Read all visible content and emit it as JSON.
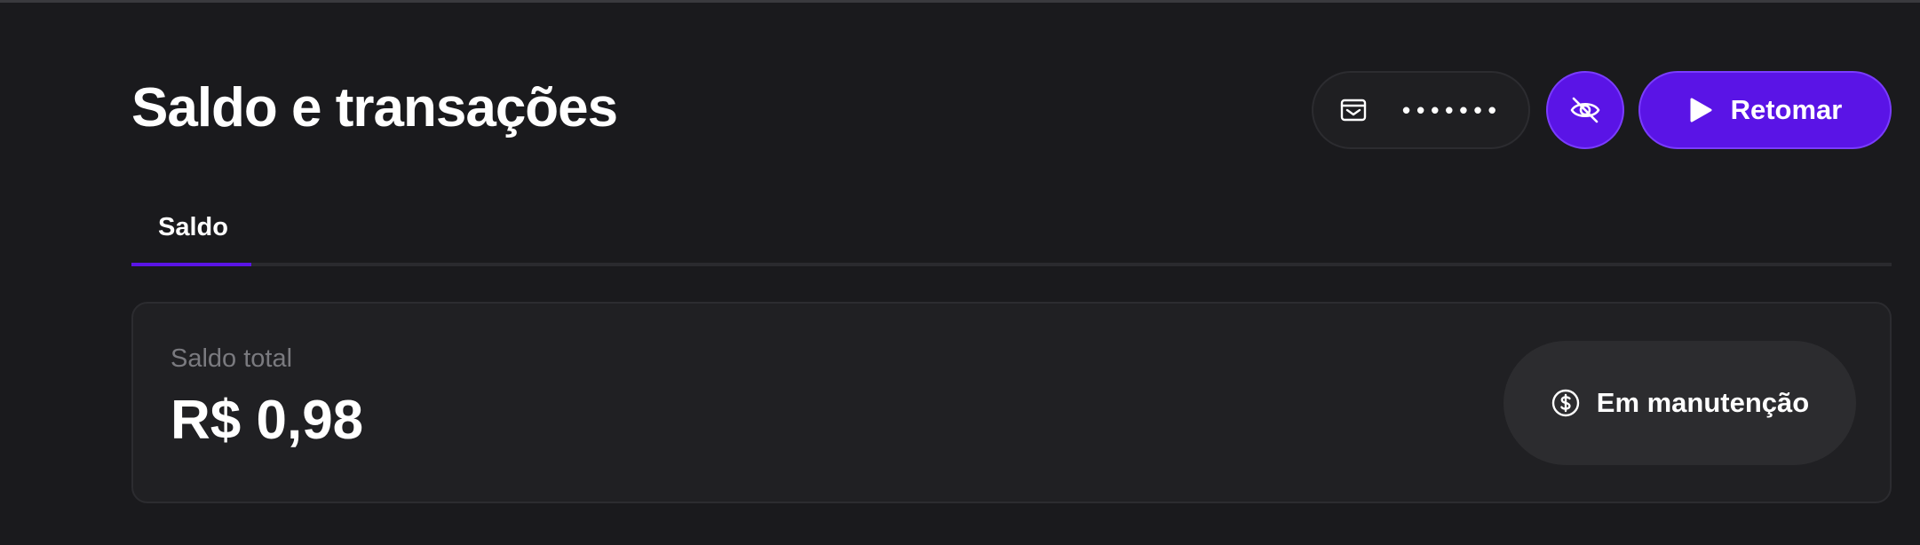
{
  "header": {
    "title": "Saldo e transações",
    "wallet": {
      "icon": "wallet-icon",
      "masked_value": "•••••••"
    },
    "visibility_toggle": {
      "icon": "eye-off-icon"
    },
    "resume_button": {
      "icon": "play-icon",
      "label": "Retomar"
    }
  },
  "tabs": [
    {
      "label": "Saldo",
      "active": true
    }
  ],
  "balance_card": {
    "label": "Saldo total",
    "value": "R$ 0,98",
    "status": {
      "icon": "dollar-circle-icon",
      "label": "Em manutenção"
    }
  },
  "colors": {
    "background": "#1a1a1d",
    "accent": "#5a14e6",
    "card": "#202023",
    "muted_text": "#7a7a7f"
  }
}
